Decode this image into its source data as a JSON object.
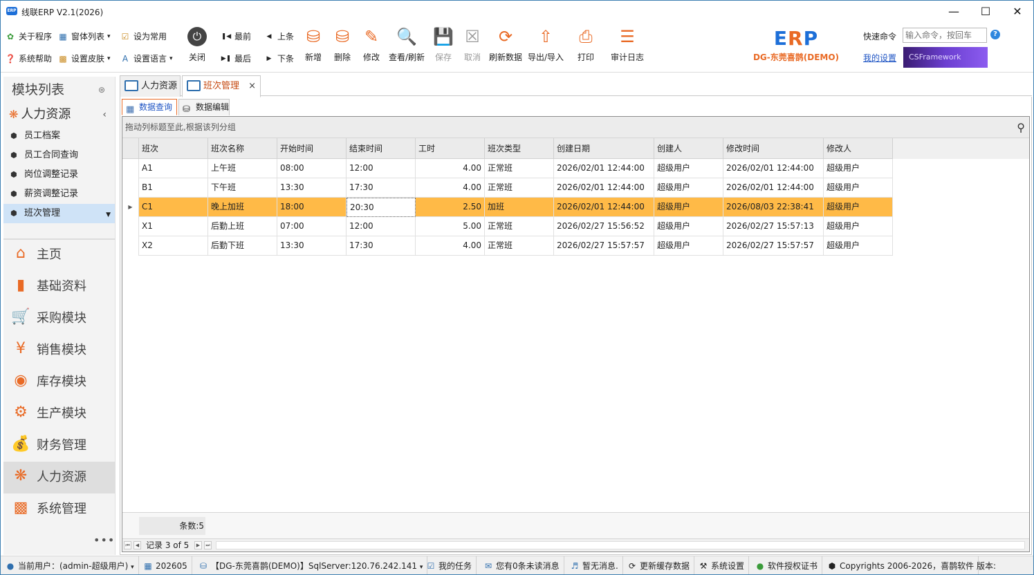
{
  "window": {
    "title": "线联ERP V2.1(2026)",
    "logo_text": "ERP"
  },
  "ribbon": {
    "small_buttons": [
      {
        "label": "关于程序",
        "icon": "about-icon"
      },
      {
        "label": "窗体列表",
        "icon": "window-list-icon"
      },
      {
        "label": "设为常用",
        "icon": "favorite-icon"
      },
      {
        "label": "系统帮助",
        "icon": "help-icon"
      },
      {
        "label": "设置皮肤",
        "icon": "skin-icon"
      },
      {
        "label": "设置语言",
        "icon": "language-icon"
      }
    ],
    "close": {
      "label": "关闭"
    },
    "nav": {
      "first": "最前",
      "prev": "上条",
      "last": "最后",
      "next": "下条"
    },
    "actions": [
      {
        "label": "新增",
        "icon": "add-icon"
      },
      {
        "label": "删除",
        "icon": "delete-icon"
      },
      {
        "label": "修改",
        "icon": "edit-icon"
      },
      {
        "label": "查看/刷新",
        "icon": "view-icon"
      },
      {
        "label": "保存",
        "icon": "save-icon"
      },
      {
        "label": "取消",
        "icon": "cancel-icon"
      },
      {
        "label": "刷新数据",
        "icon": "refresh-icon"
      },
      {
        "label": "导出/导入",
        "icon": "export-icon"
      },
      {
        "label": "打印",
        "icon": "print-icon"
      },
      {
        "label": "审计日志",
        "icon": "audit-log-icon"
      }
    ],
    "brand": {
      "logo_e": "E",
      "logo_r": "R",
      "logo_p": "P",
      "company": "DG-东莞喜鹊(DEMO)"
    },
    "quick_command": {
      "label": "快速命令",
      "placeholder": "输入命令，按回车"
    },
    "my_settings": "我的设置",
    "banner": "CSFramework"
  },
  "left_panel": {
    "title": "模块列表",
    "group": "人力资源",
    "items": [
      "员工档案",
      "员工合同查询",
      "岗位调整记录",
      "薪资调整记录",
      "班次管理"
    ],
    "nav": [
      "主页",
      "基础资料",
      "采购模块",
      "销售模块",
      "库存模块",
      "生产模块",
      "财务管理",
      "人力资源",
      "系统管理"
    ],
    "more": "•••"
  },
  "doc_tabs": [
    {
      "label": "人力资源"
    },
    {
      "label": "班次管理"
    }
  ],
  "sub_tabs": [
    {
      "label": "数据查询"
    },
    {
      "label": "数据编辑"
    }
  ],
  "grid": {
    "group_hint": "拖动列标题至此,根据该列分组",
    "columns": [
      "班次",
      "班次名称",
      "开始时间",
      "结束时间",
      "工时",
      "班次类型",
      "创建日期",
      "创建人",
      "修改时间",
      "修改人"
    ],
    "rows": [
      [
        "A1",
        "上午班",
        "08:00",
        "12:00",
        "4.00",
        "正常班",
        "2026/02/01 12:44:00",
        "超级用户",
        "2026/02/01 12:44:00",
        "超级用户"
      ],
      [
        "B1",
        "下午班",
        "13:30",
        "17:30",
        "4.00",
        "正常班",
        "2026/02/01 12:44:00",
        "超级用户",
        "2026/02/01 12:44:00",
        "超级用户"
      ],
      [
        "C1",
        "晚上加班",
        "18:00",
        "20:30",
        "2.50",
        "加班",
        "2026/02/01 12:44:00",
        "超级用户",
        "2026/08/03 22:38:41",
        "超级用户"
      ],
      [
        "X1",
        "后勤上班",
        "07:00",
        "12:00",
        "5.00",
        "正常班",
        "2026/02/27 15:56:52",
        "超级用户",
        "2026/02/27 15:57:13",
        "超级用户"
      ],
      [
        "X2",
        "后勤下班",
        "13:30",
        "17:30",
        "4.00",
        "正常班",
        "2026/02/27 15:57:57",
        "超级用户",
        "2026/02/27 15:57:57",
        "超级用户"
      ]
    ],
    "selected_row": 2,
    "count_label": "条数:5",
    "record_nav": "记录 3 of 5"
  },
  "status_bar": {
    "user": "当前用户：(admin-超级用户)",
    "period": "202605",
    "db": "【DG-东莞喜鹊(DEMO)】SqlServer:120.76.242.141",
    "tasks": "我的任务",
    "unread": "您有0条未读消息",
    "no_msg": "暂无消息.",
    "cache": "更新缓存数据",
    "settings": "系统设置",
    "license": "软件授权证书",
    "copyright": "Copyrights 2006-2026，喜鹊软件",
    "version": "版本:"
  },
  "colors": {
    "accent": "#e96a25",
    "selected_row": "#ffba47",
    "link": "#1f55c4",
    "frame": "#3c7fb1"
  }
}
